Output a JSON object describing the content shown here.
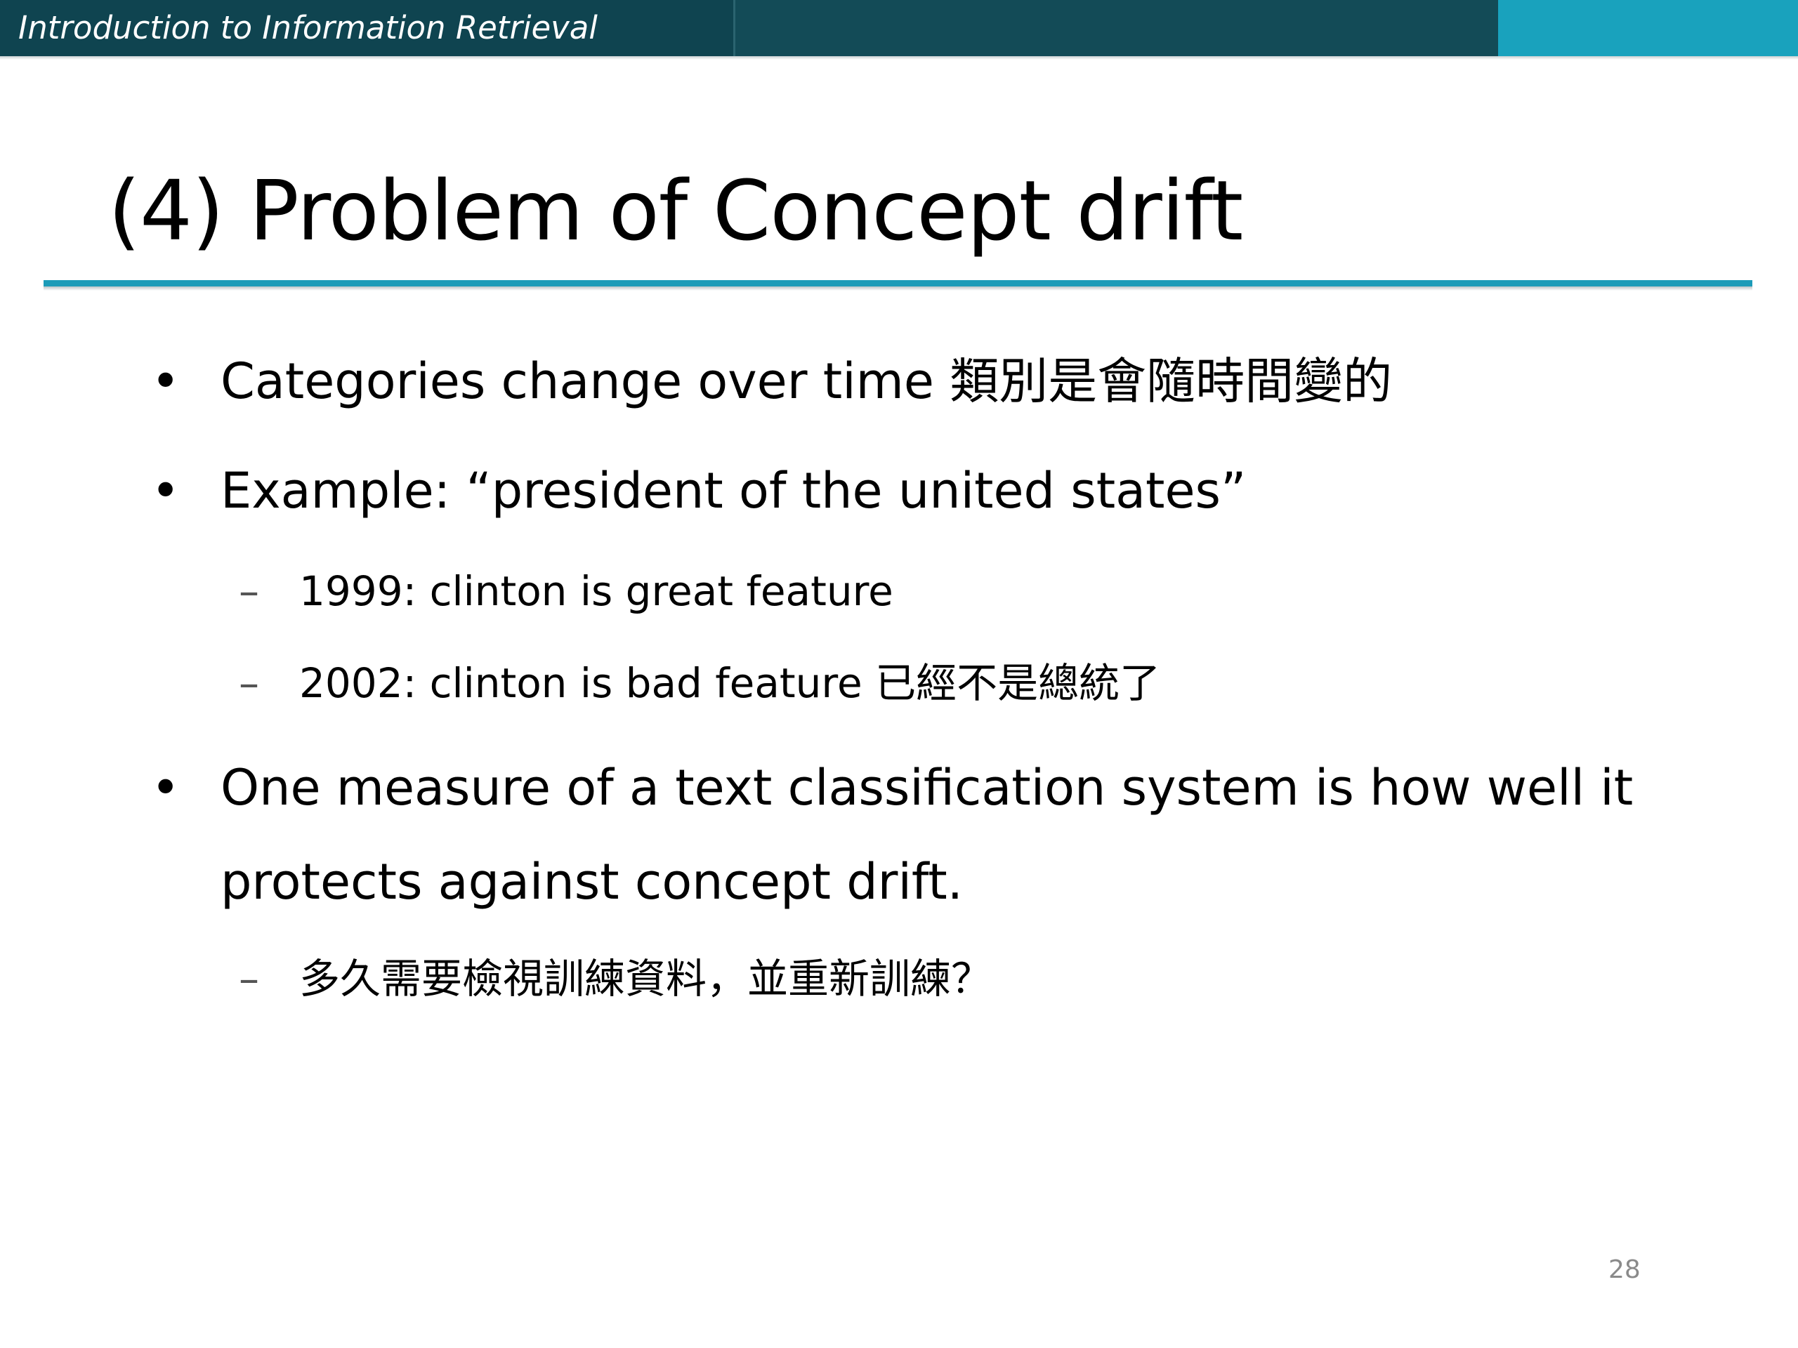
{
  "header": {
    "course_title": "Introduction to Information Retrieval"
  },
  "slide": {
    "title": "(4) Problem of Concept drift",
    "bullets": [
      {
        "marker": "•",
        "text": "Categories change over time 類別是會隨時間變的"
      },
      {
        "marker": "•",
        "text": "Example: “president of the united states”",
        "sub": [
          {
            "marker": "–",
            "text": "1999: clinton is great feature"
          },
          {
            "marker": "–",
            "text": "2002: clinton is bad feature 已經不是總統了"
          }
        ]
      },
      {
        "marker": "•",
        "lines": [
          "One measure of a text classification system is how well it",
          "protects against concept drift."
        ],
        "sub": [
          {
            "marker": "–",
            "text": "多久需要檢視訓練資料，並重新訓練？"
          }
        ]
      }
    ],
    "page_number": "28"
  },
  "colors": {
    "banner_dark": "#0f4450",
    "banner_accent": "#19a2bd",
    "title_rule": "#1b9bb8"
  }
}
